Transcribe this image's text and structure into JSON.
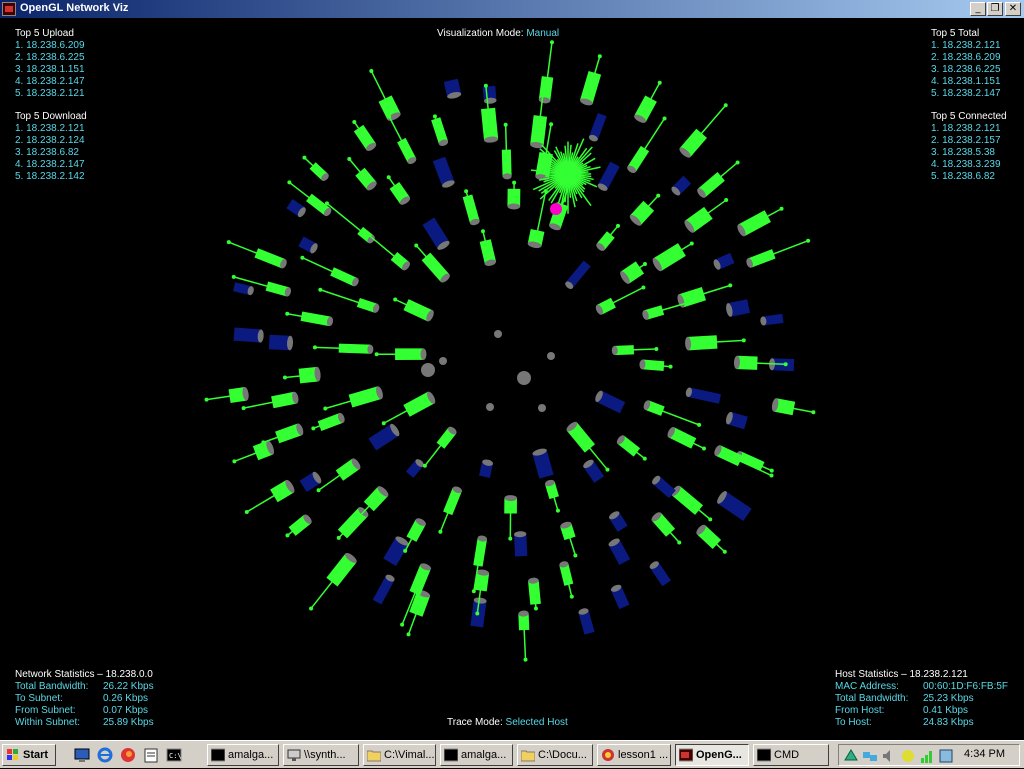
{
  "window": {
    "title": "OpenGL Network Viz"
  },
  "mode": {
    "label": "Visualization Mode:",
    "value": "Manual"
  },
  "top_upload": {
    "title": "Top 5 Upload",
    "items": [
      "1. 18.238.6.209",
      "2. 18.238.6.225",
      "3. 18.238.1.151",
      "4. 18.238.2.147",
      "5. 18.238.2.121"
    ]
  },
  "top_download": {
    "title": "Top 5 Download",
    "items": [
      "1. 18.238.2.121",
      "2. 18.238.2.124",
      "3. 18.238.6.82",
      "4. 18.238.2.147",
      "5. 18.238.2.142"
    ]
  },
  "top_total": {
    "title": "Top 5 Total",
    "items": [
      "1. 18.238.2.121",
      "2. 18.238.6.209",
      "3. 18.238.6.225",
      "4. 18.238.1.151",
      "5. 18.238.2.147"
    ]
  },
  "top_connected": {
    "title": "Top 5 Connected",
    "items": [
      "1. 18.238.2.121",
      "2. 18.238.2.157",
      "3. 18.238.5.38",
      "4. 18.238.3.239",
      "5. 18.238.6.82"
    ]
  },
  "net_stats": {
    "title": "Network Statistics – 18.238.0.0",
    "rows": [
      {
        "k": "Total Bandwidth:",
        "v": "26.22 Kbps"
      },
      {
        "k": "To Subnet:",
        "v": "0.26 Kbps"
      },
      {
        "k": "From Subnet:",
        "v": "0.07 Kbps"
      },
      {
        "k": "Within Subnet:",
        "v": "25.89 Kbps"
      }
    ]
  },
  "host_stats": {
    "title": "Host Statistics – 18.238.2.121",
    "rows": [
      {
        "k": "MAC Address:",
        "v": "00:60:1D:F6:FB:5F"
      },
      {
        "k": "Total Bandwidth:",
        "v": "25.23 Kbps"
      },
      {
        "k": "From Host:",
        "v": "0.41 Kbps"
      },
      {
        "k": "To Host:",
        "v": "24.83 Kbps"
      }
    ]
  },
  "trace": {
    "label": "Trace Mode:",
    "value": "Selected Host"
  },
  "colors": {
    "green": "#33ff33",
    "blue": "#0a1a80",
    "gray": "#777777",
    "magenta": "#ff00cc",
    "cyan": "#58d8e8"
  },
  "taskbar": {
    "start": "Start",
    "quick_launch": [
      "desktop-icon",
      "ie-icon",
      "firefox-icon",
      "notepad-icon",
      "cmd-icon"
    ],
    "buttons": [
      {
        "label": "amalga...",
        "icon": "terminal-icon"
      },
      {
        "label": "\\\\synth...",
        "icon": "network-icon"
      },
      {
        "label": "C:\\Vimal...",
        "icon": "folder-icon"
      },
      {
        "label": "amalga...",
        "icon": "terminal-icon"
      },
      {
        "label": "C:\\Docu...",
        "icon": "folder-icon"
      },
      {
        "label": "lesson1 ...",
        "icon": "app-icon"
      },
      {
        "label": "OpenG...",
        "icon": "opengl-icon"
      },
      {
        "label": "CMD",
        "icon": "cmd-icon"
      }
    ],
    "clock": "4:34 PM"
  }
}
